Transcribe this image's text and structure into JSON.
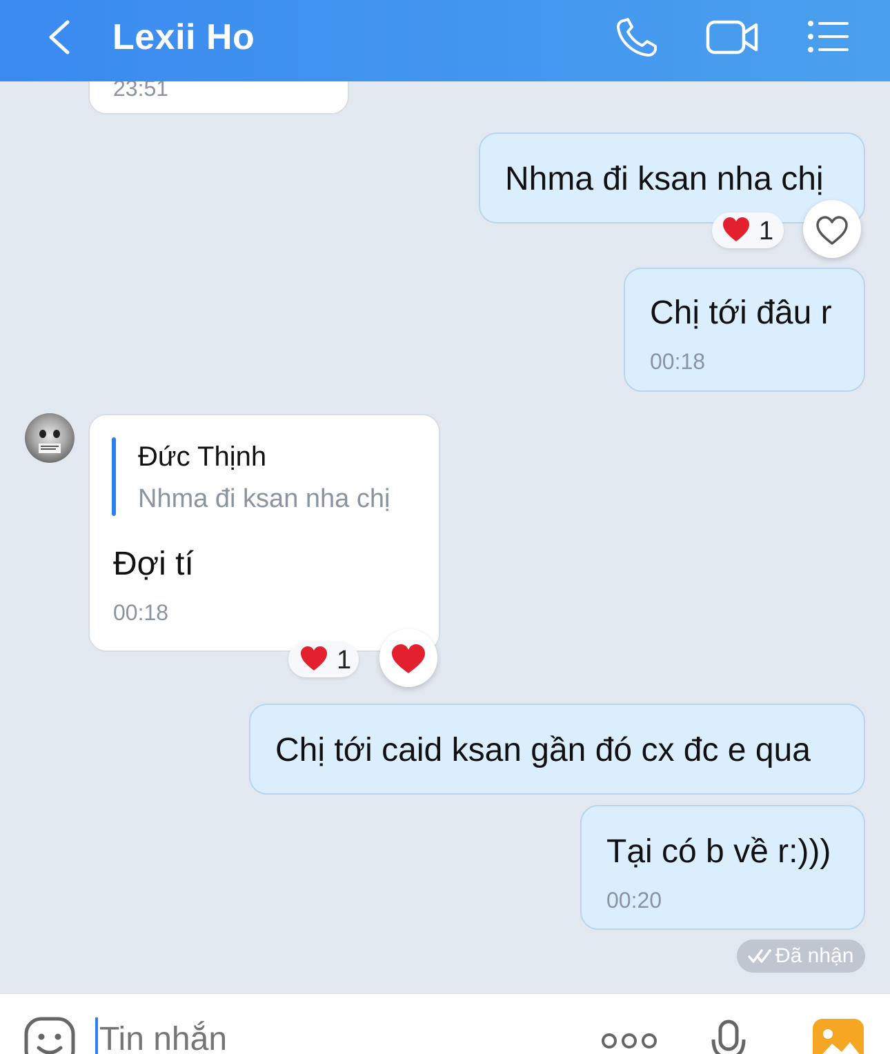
{
  "header": {
    "title": "Lexii Ho",
    "back_icon": "chevron-left-icon",
    "call_icon": "phone-icon",
    "video_icon": "video-camera-icon",
    "menu_icon": "list-menu-icon"
  },
  "messages": [
    {
      "direction": "incoming",
      "time": "23:51"
    },
    {
      "direction": "outgoing",
      "text": "Nhma đi ksan nha chị",
      "reaction": {
        "emoji": "❤️",
        "count": "1",
        "button_icon": "heart-outline-icon"
      }
    },
    {
      "direction": "outgoing",
      "text": "Chị tới đâu r",
      "time": "00:18"
    },
    {
      "direction": "incoming",
      "quote": {
        "author": "Đức Thịnh",
        "text": "Nhma đi ksan nha chị"
      },
      "text": "Đợi tí",
      "time": "00:18",
      "reaction": {
        "emoji": "❤️",
        "count": "1",
        "button_icon": "heart-filled-icon"
      }
    },
    {
      "direction": "outgoing",
      "text": "Chị tới caid ksan gần đó cx đc e qua"
    },
    {
      "direction": "outgoing",
      "text": "Tại có b về r:)))",
      "time": "00:20"
    }
  ],
  "status": {
    "icon": "double-check-icon",
    "text": "Đã nhận"
  },
  "composer": {
    "placeholder": "Tin nhắn",
    "emoji_icon": "sticker-smile-icon",
    "more_icon": "more-dots-icon",
    "mic_icon": "microphone-icon",
    "gallery_icon": "image-gallery-icon"
  },
  "colors": {
    "header_start": "#3a8af0",
    "header_end": "#4aa0ee",
    "outgoing_bubble": "#dbeefd",
    "incoming_bubble": "#ffffff",
    "background": "#e2e8f0",
    "quote_bar": "#2b7ff0",
    "heart": "#e3202e"
  }
}
